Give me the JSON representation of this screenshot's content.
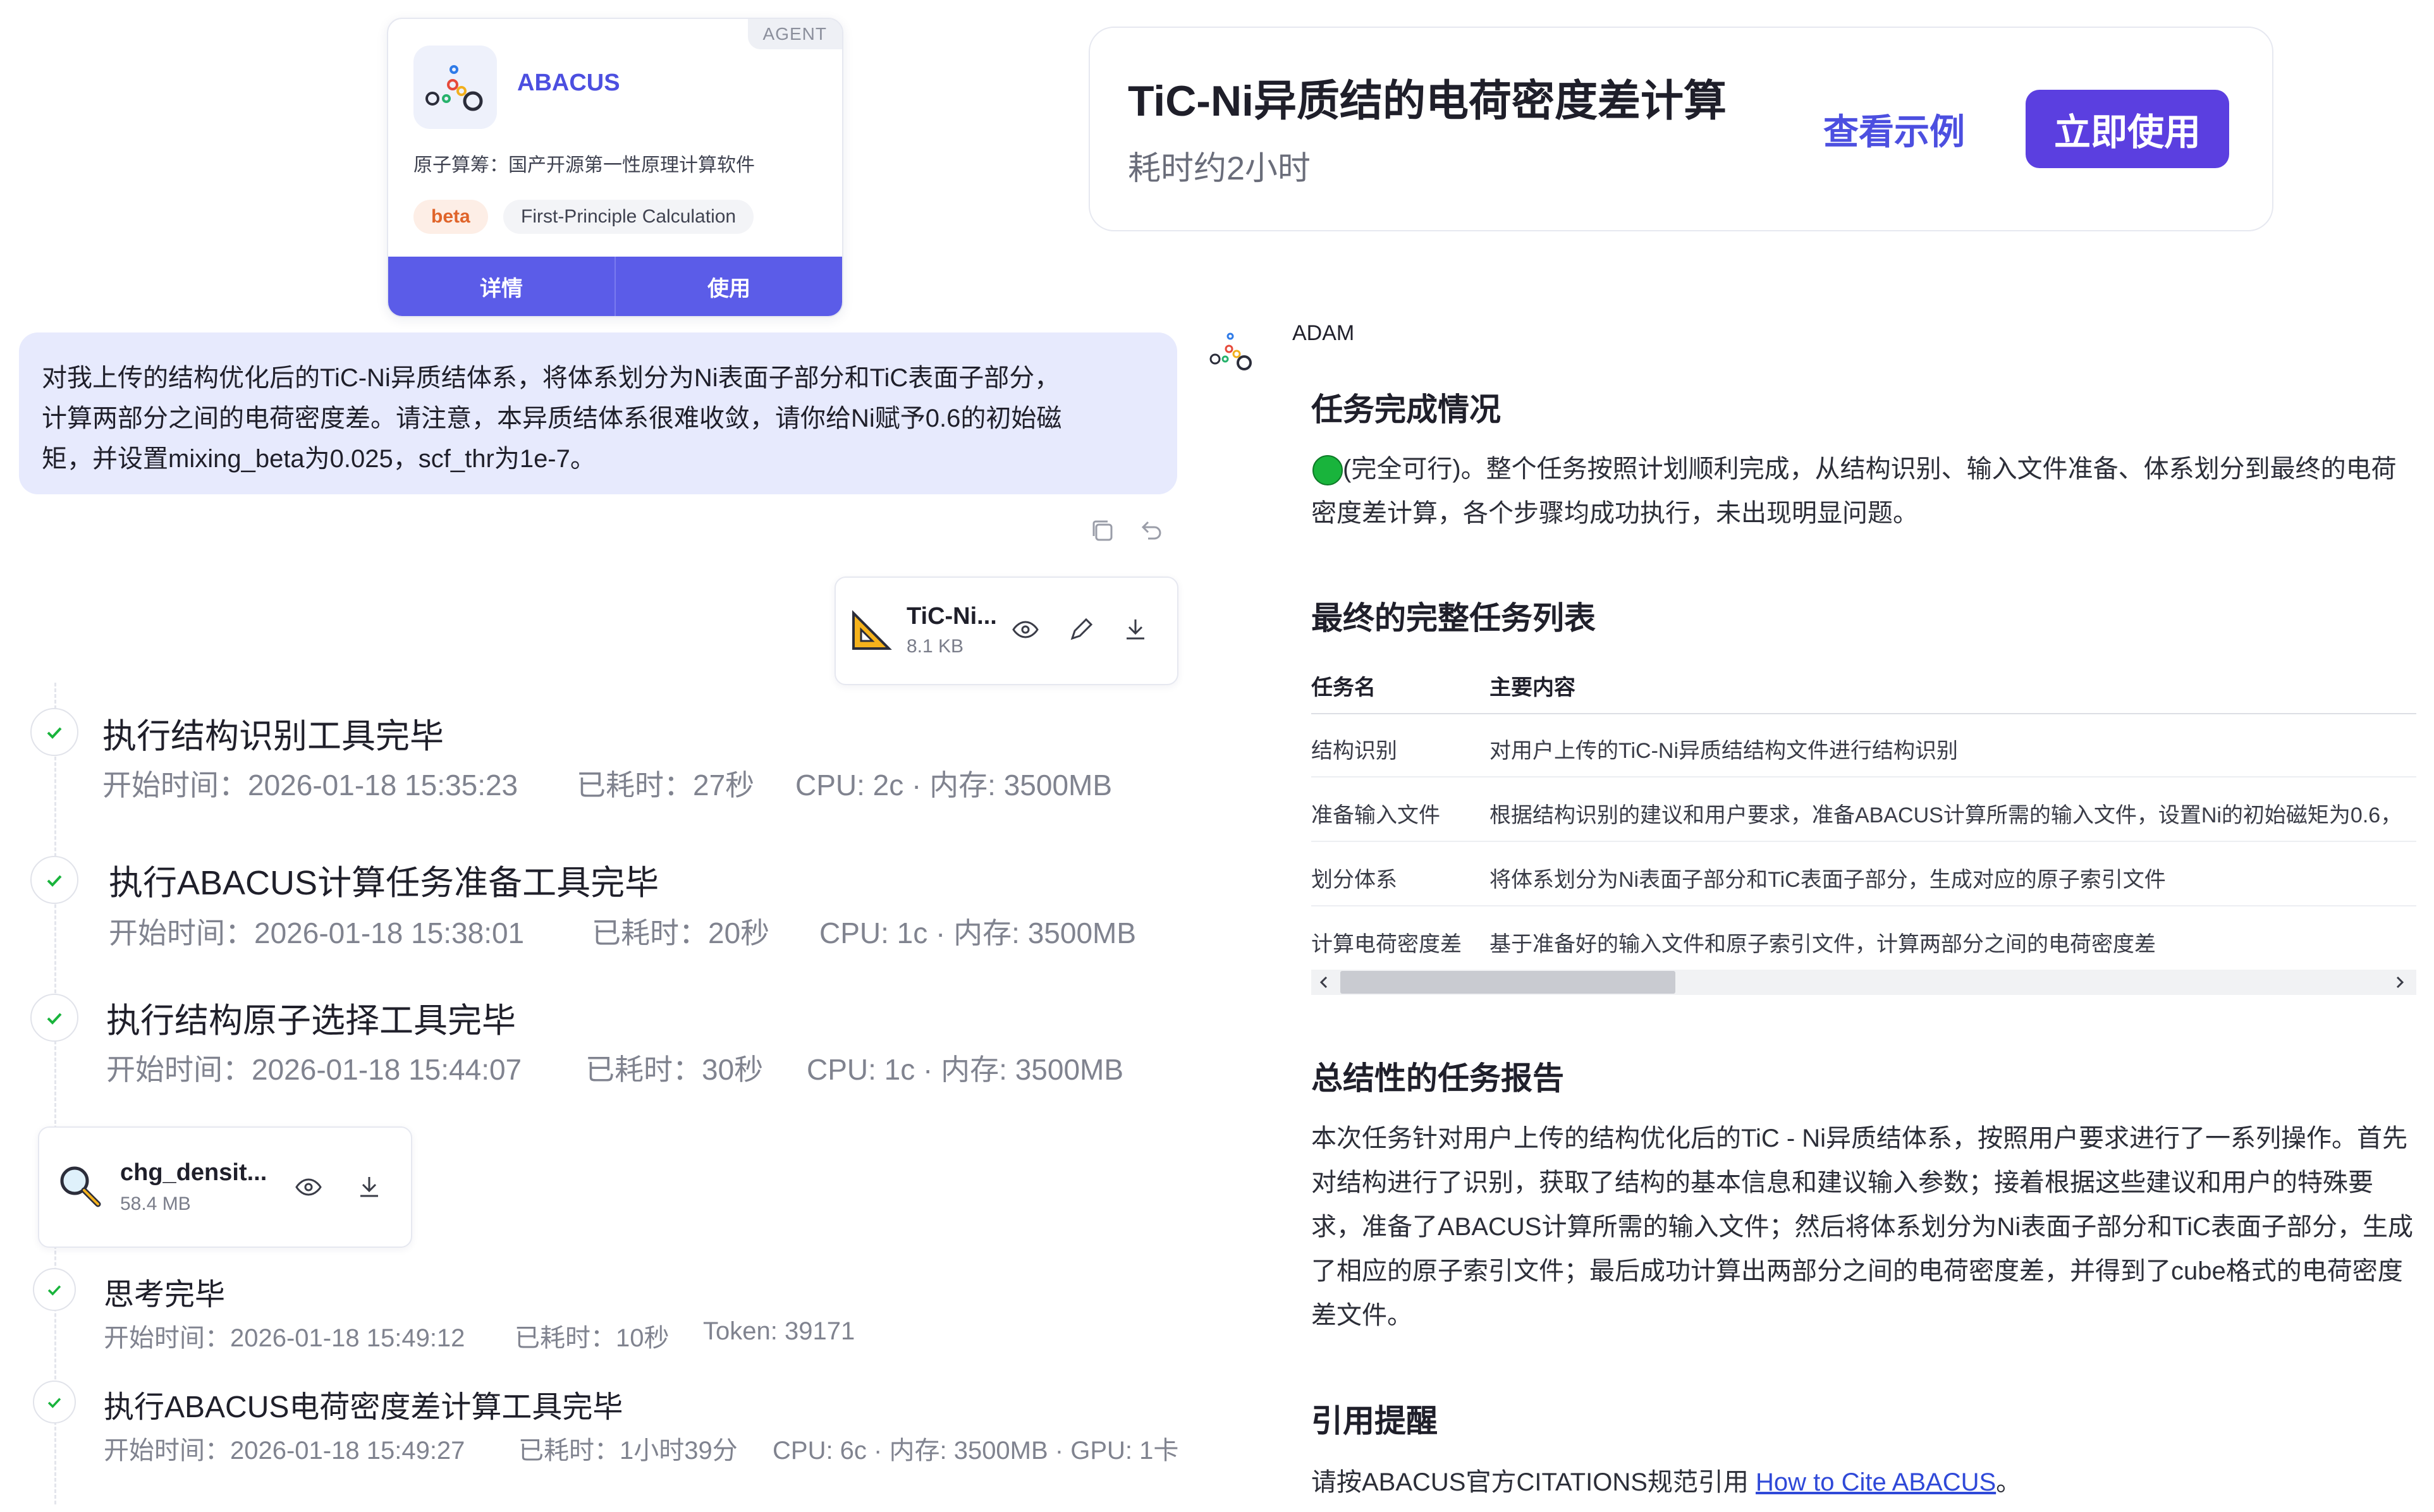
{
  "agent_card": {
    "tag": "AGENT",
    "name": "ABACUS",
    "description": "原子算筹：国产开源第一性原理计算软件",
    "badge": "beta",
    "category": "First-Principle Calculation",
    "details_label": "详情",
    "use_label": "使用"
  },
  "banner": {
    "title": "TiC-Ni异质结的电荷密度差计算",
    "duration": "耗时约2小时",
    "example_label": "查看示例",
    "use_now_label": "立即使用"
  },
  "user_message": {
    "line1": "对我上传的结构优化后的TiC-Ni异质结体系，将体系划分为Ni表面子部分和TiC表面子部分，",
    "line2": "计算两部分之间的电荷密度差。请注意，本异质结体系很难收敛，请你给Ni赋予0.6的初始磁",
    "line3": "矩，并设置mixing_beta为0.025，scf_thr为1e-7。"
  },
  "files": {
    "upload": {
      "name": "TiC-Ni...",
      "size": "8.1 KB",
      "icon": "ruler-triangle-icon"
    },
    "output": {
      "name": "chg_densit...",
      "size": "58.4 MB",
      "icon": "magnifier-icon"
    }
  },
  "steps": [
    {
      "title": "执行结构识别工具完毕",
      "start": "开始时间：2026-01-18 15:35:23",
      "elapsed": "已耗时：27秒",
      "resources": "CPU: 2c · 内存: 3500MB"
    },
    {
      "title": "执行ABACUS计算任务准备工具完毕",
      "start": "开始时间：2026-01-18 15:38:01",
      "elapsed": "已耗时：20秒",
      "resources": "CPU: 1c · 内存: 3500MB"
    },
    {
      "title": "执行结构原子选择工具完毕",
      "start": "开始时间：2026-01-18 15:44:07",
      "elapsed": "已耗时：30秒",
      "resources": "CPU: 1c · 内存: 3500MB"
    },
    {
      "title": "思考完毕",
      "start": "开始时间：2026-01-18 15:49:12",
      "elapsed": "已耗时：10秒",
      "resources": "Token: 39171"
    },
    {
      "title": "执行ABACUS电荷密度差计算工具完毕",
      "start": "开始时间：2026-01-18 15:49:27",
      "elapsed": "已耗时：1小时39分",
      "resources": "CPU: 6c · 内存: 3500MB · GPU: 1卡"
    }
  ],
  "assistant": {
    "name": "ADAM",
    "completion": {
      "heading": "任务完成情况",
      "line1": "(完全可行)。整个任务按照计划顺利完成，从结构识别、输入文件准备、体系划分到最终的电荷",
      "line2": "密度差计算，各个步骤均成功执行，未出现明显问题。",
      "status_color": "#19b43c"
    },
    "task_list": {
      "heading": "最终的完整任务列表",
      "col_name": "任务名",
      "col_content": "主要内容",
      "rows": [
        {
          "name": "结构识别",
          "content": "对用户上传的TiC-Ni异质结结构文件进行结构识别"
        },
        {
          "name": "准备输入文件",
          "content": "根据结构识别的建议和用户要求，准备ABACUS计算所需的输入文件，设置Ni的初始磁矩为0.6，"
        },
        {
          "name": "划分体系",
          "content": "将体系划分为Ni表面子部分和TiC表面子部分，生成对应的原子索引文件"
        },
        {
          "name": "计算电荷密度差",
          "content": "基于准备好的输入文件和原子索引文件，计算两部分之间的电荷密度差"
        }
      ]
    },
    "report": {
      "heading": "总结性的任务报告",
      "lines": [
        "本次任务针对用户上传的结构优化后的TiC - Ni异质结体系，按照用户要求进行了一系列操作。首先",
        "对结构进行了识别，获取了结构的基本信息和建议输入参数；接着根据这些建议和用户的特殊要",
        "求，准备了ABACUS计算所需的输入文件；然后将体系划分为Ni表面子部分和TiC表面子部分，生成",
        "了相应的原子索引文件；最后成功计算出两部分之间的电荷密度差，并得到了cube格式的电荷密度",
        "差文件。"
      ]
    },
    "citation": {
      "heading": "引用提醒",
      "prefix": "请按ABACUS官方CITATIONS规范引用 ",
      "link": "How to Cite ABACUS",
      "suffix": "。"
    }
  },
  "colors": {
    "accent": "#5b5ce8",
    "primary_button": "#5b3fe0",
    "user_bubble": "#e7eafd",
    "check": "#19b43c"
  }
}
